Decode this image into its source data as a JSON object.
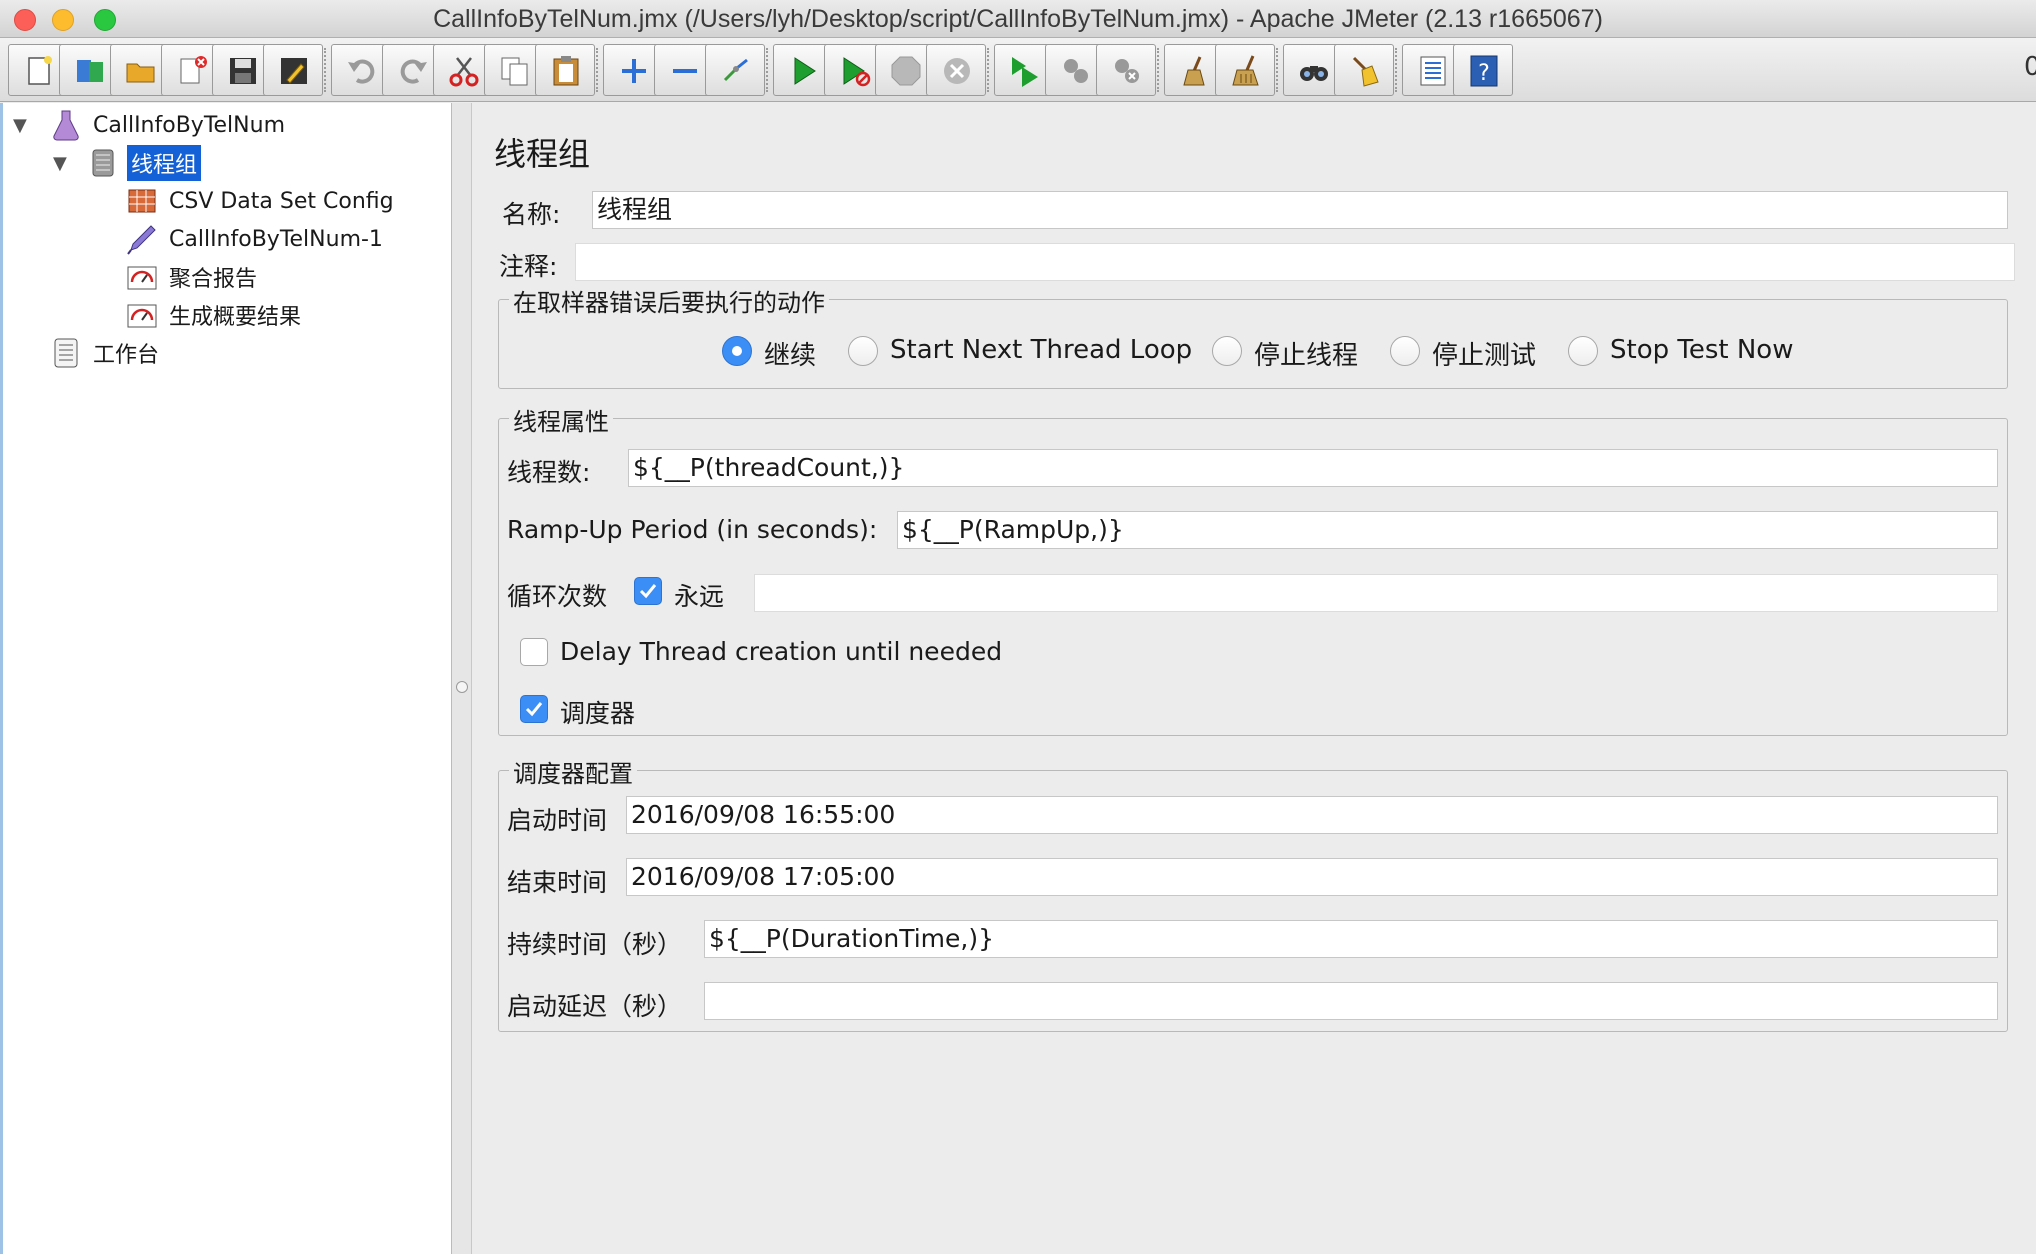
{
  "window": {
    "title": "CallInfoByTelNum.jmx (/Users/lyh/Desktop/script/CallInfoByTelNum.jmx) - Apache JMeter (2.13 r1665067)"
  },
  "toolbar": {
    "tail_text": "0",
    "buttons": [
      {
        "name": "new-icon"
      },
      {
        "name": "templates-icon"
      },
      {
        "name": "open-icon"
      },
      {
        "name": "close-icon"
      },
      {
        "name": "save-icon"
      },
      {
        "name": "save-as-icon"
      },
      {
        "name": "undo-icon"
      },
      {
        "name": "redo-icon"
      },
      {
        "name": "cut-icon"
      },
      {
        "name": "copy-icon"
      },
      {
        "name": "paste-icon"
      },
      {
        "name": "expand-icon"
      },
      {
        "name": "collapse-icon"
      },
      {
        "name": "toggle-icon"
      },
      {
        "name": "start-icon"
      },
      {
        "name": "start-no-pause-icon"
      },
      {
        "name": "stop-icon"
      },
      {
        "name": "shutdown-icon"
      },
      {
        "name": "remote-start-icon"
      },
      {
        "name": "remote-stop-icon"
      },
      {
        "name": "remote-shutdown-icon"
      },
      {
        "name": "clear-icon"
      },
      {
        "name": "clear-all-icon"
      },
      {
        "name": "search-icon"
      },
      {
        "name": "reset-search-icon"
      },
      {
        "name": "function-helper-icon"
      },
      {
        "name": "help-icon"
      }
    ]
  },
  "tree": {
    "nodes": [
      {
        "label": "CallInfoByTelNum",
        "icon": "test-plan-icon"
      },
      {
        "label": "线程组",
        "icon": "thread-group-icon",
        "selected": true
      },
      {
        "label": "CSV Data Set Config",
        "icon": "csv-config-icon"
      },
      {
        "label": "CallInfoByTelNum-1",
        "icon": "sampler-icon"
      },
      {
        "label": "聚合报告",
        "icon": "listener-icon"
      },
      {
        "label": "生成概要结果",
        "icon": "listener-icon"
      },
      {
        "label": "工作台",
        "icon": "workbench-icon"
      }
    ]
  },
  "panel": {
    "title": "线程组",
    "name_label": "名称:",
    "name_value": "线程组",
    "comment_label": "注释:",
    "comment_value": "",
    "error_action": {
      "legend": "在取样器错误后要执行的动作",
      "options": [
        {
          "label": "继续",
          "selected": true
        },
        {
          "label": "Start Next Thread Loop",
          "selected": false
        },
        {
          "label": "停止线程",
          "selected": false
        },
        {
          "label": "停止测试",
          "selected": false
        },
        {
          "label": "Stop Test Now",
          "selected": false
        }
      ]
    },
    "thread_props": {
      "legend": "线程属性",
      "threads_label": "线程数:",
      "threads_value": "${__P(threadCount,)}",
      "rampup_label": "Ramp-Up Period (in seconds):",
      "rampup_value": "${__P(RampUp,)}",
      "loop_label": "循环次数",
      "forever_label": "永远",
      "forever_checked": true,
      "loop_value": "",
      "delay_label": "Delay Thread creation until needed",
      "delay_checked": false,
      "scheduler_label": "调度器",
      "scheduler_checked": true
    },
    "scheduler": {
      "legend": "调度器配置",
      "start_label": "启动时间",
      "start_value": "2016/09/08 16:55:00",
      "end_label": "结束时间",
      "end_value": "2016/09/08 17:05:00",
      "duration_label": "持续时间（秒）",
      "duration_value": "${__P(DurationTime,)}",
      "delay_label": "启动延迟（秒）",
      "delay_value": ""
    }
  }
}
